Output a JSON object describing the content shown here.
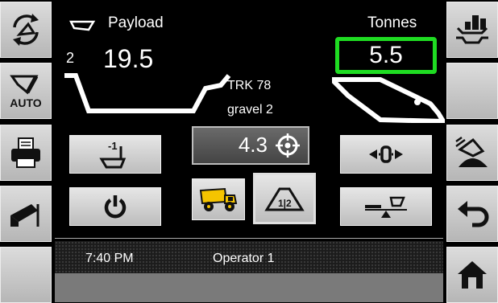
{
  "header": {
    "payload_label": "Payload",
    "tonnes_label": "Tonnes",
    "bucket_index": "2",
    "payload_value": "19.5",
    "tonnes_value": "5.5"
  },
  "truck": {
    "name": "TRK 78",
    "material": "gravel 2"
  },
  "target": {
    "value": "4.3"
  },
  "status": {
    "time": "7:40 PM",
    "operator": "Operator 1"
  },
  "buttons": {
    "auto_label": "AUTO",
    "tip_off_label": "-1",
    "material_label": "1|2"
  },
  "colors": {
    "highlight": "#1fdc22",
    "button_bg": "#c8c8c8",
    "background": "#000000"
  },
  "icons": {
    "left_column": [
      "recycle-bucket-icon",
      "auto-bucket-icon",
      "printer-icon",
      "bucket-camera-icon",
      "blank"
    ],
    "right_column": [
      "settings-icon",
      "blank",
      "pile-dig-icon",
      "undo-icon",
      "home-icon"
    ]
  }
}
